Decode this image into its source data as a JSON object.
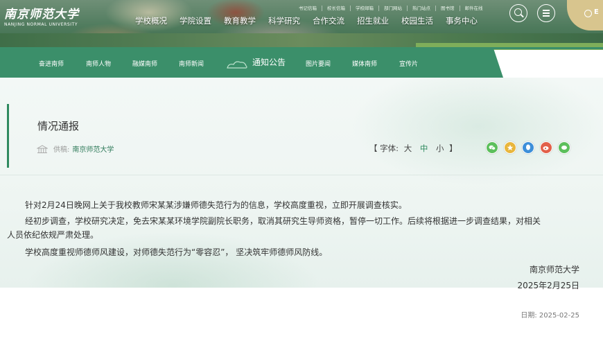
{
  "logo": {
    "cn": "南京师范大学",
    "en": "NANJING NORMAL UNIVERSITY"
  },
  "top_links": [
    "书记信箱",
    "校长信箱",
    "学校邮箱",
    "部门网站",
    "热门站点",
    "图书馆",
    "邮件在线"
  ],
  "main_nav": [
    "学校概况",
    "学院设置",
    "教育教学",
    "科学研究",
    "合作交流",
    "招生就业",
    "校园生活",
    "事务中心"
  ],
  "lang_label": "E",
  "sub_nav": {
    "items": [
      "奋进南师",
      "南师人物",
      "融媒南师",
      "南师新闻",
      "图片要闻",
      "媒体南师",
      "宣传片"
    ],
    "active": "通知公告"
  },
  "article": {
    "title": "情况通报",
    "source_label": "供稿:",
    "source": "南京师范大学",
    "font_label": "【 字体:",
    "font_large": "大",
    "font_mid": "中",
    "font_small": "小",
    "font_close": "】",
    "paragraphs": [
      "针对2月24日晚网上关于我校教师宋某某涉嫌师德失范行为的信息，学校高度重视，立即开展调查核实。",
      "经初步调查，学校研究决定，免去宋某某环境学院副院长职务，取消其研究生导师资格，暂停一切工作。后续将根据进一步调查结果，对相关",
      "人员依纪依规严肃处理。",
      "学校高度重视师德师风建设，对师德失范行为“零容忍”，  坚决筑牢师德师风防线。"
    ],
    "signature": "南京师范大学",
    "sign_date": "2025年2月25日",
    "publish_date": "日期: 2025-02-25"
  },
  "share_icons": [
    {
      "name": "wechat-icon",
      "color": "#5cbf5c"
    },
    {
      "name": "qzone-icon",
      "color": "#e8b63c"
    },
    {
      "name": "qq-icon",
      "color": "#3d8fd9"
    },
    {
      "name": "weibo-icon",
      "color": "#e2604a"
    },
    {
      "name": "wechat-moments-icon",
      "color": "#5cbf5c"
    }
  ],
  "colors": {
    "brand_green": "#3b8f6a",
    "accent_gold": "#d8c58e"
  }
}
